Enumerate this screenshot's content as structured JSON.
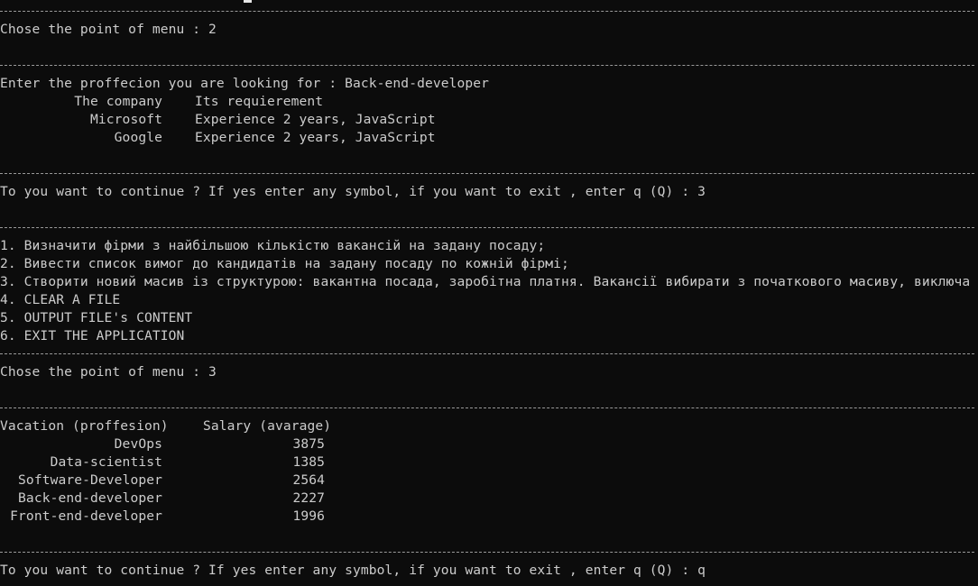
{
  "session1": {
    "menu_prompt": "Chose the point of menu : 2",
    "profession_prompt": "Enter the proffecion you are looking for : Back-end-developer",
    "header_company": "The company",
    "header_requirement": "Its requierement",
    "rows": [
      {
        "company": "Microsoft",
        "requirement": "Experience 2 years, JavaScript"
      },
      {
        "company": "Google",
        "requirement": "Experience 2 years, JavaScript"
      }
    ],
    "continue_prompt": "To you want to continue ? If yes enter any symbol, if you want to exit , enter q (Q) : 3"
  },
  "menu": {
    "items": [
      "1. Визначити фірми з найбільшою кількістю вакансій на задану посаду;",
      "2. Вивести список вимог до кандидатів на задану посаду по кожній фірмі;",
      "3. Створити новий масив із структурою: вакантна посада, заробітна платня. Вакансії вибирати з початкового масиву, виключа",
      "4. CLEAR A FILE",
      "5. OUTPUT FILE's CONTENT",
      "6. EXIT THE APPLICATION"
    ]
  },
  "session2": {
    "menu_prompt": "Chose the point of menu : 3",
    "header_vacation": "Vacation (proffesion)",
    "header_salary": "Salary (avarage)",
    "rows": [
      {
        "profession": "DevOps",
        "salary": "3875"
      },
      {
        "profession": "Data-scientist",
        "salary": "1385"
      },
      {
        "profession": "Software-Developer",
        "salary": "2564"
      },
      {
        "profession": "Back-end-developer",
        "salary": "2227"
      },
      {
        "profession": "Front-end-developer",
        "salary": "1996"
      }
    ],
    "continue_prompt": "To you want to continue ? If yes enter any symbol, if you want to exit , enter q (Q) : q"
  },
  "colors": {
    "background": "#0c0c0c",
    "text": "#cccccc",
    "cursor": "#e6e6e6"
  }
}
